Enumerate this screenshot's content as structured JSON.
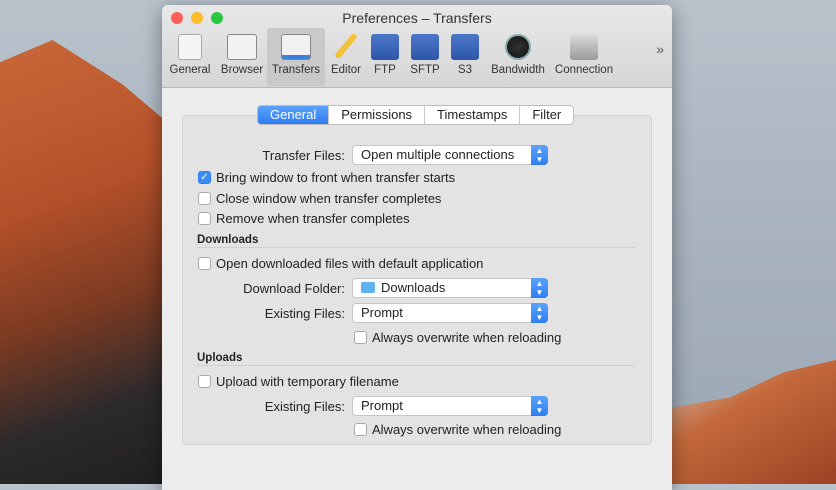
{
  "window": {
    "title": "Preferences – Transfers"
  },
  "toolbar": [
    {
      "label": "General"
    },
    {
      "label": "Browser"
    },
    {
      "label": "Transfers"
    },
    {
      "label": "Editor"
    },
    {
      "label": "FTP"
    },
    {
      "label": "SFTP"
    },
    {
      "label": "S3"
    },
    {
      "label": "Bandwidth"
    },
    {
      "label": "Connection"
    }
  ],
  "toolbar_more": "»",
  "tabs": [
    "General",
    "Permissions",
    "Timestamps",
    "Filter"
  ],
  "general": {
    "transfer_files_label": "Transfer Files:",
    "transfer_files_value": "Open multiple connections",
    "bring_front": "Bring window to front when transfer starts",
    "bring_front_checked": true,
    "close_window": "Close window when transfer completes",
    "close_window_checked": false,
    "remove": "Remove when transfer completes",
    "remove_checked": false
  },
  "downloads": {
    "header": "Downloads",
    "open_default": "Open downloaded files with default application",
    "folder_label": "Download Folder:",
    "folder_value": "Downloads",
    "existing_label": "Existing Files:",
    "existing_value": "Prompt",
    "overwrite": "Always overwrite when reloading"
  },
  "uploads": {
    "header": "Uploads",
    "temp_filename": "Upload with temporary filename",
    "existing_label": "Existing Files:",
    "existing_value": "Prompt",
    "overwrite": "Always overwrite when reloading"
  }
}
